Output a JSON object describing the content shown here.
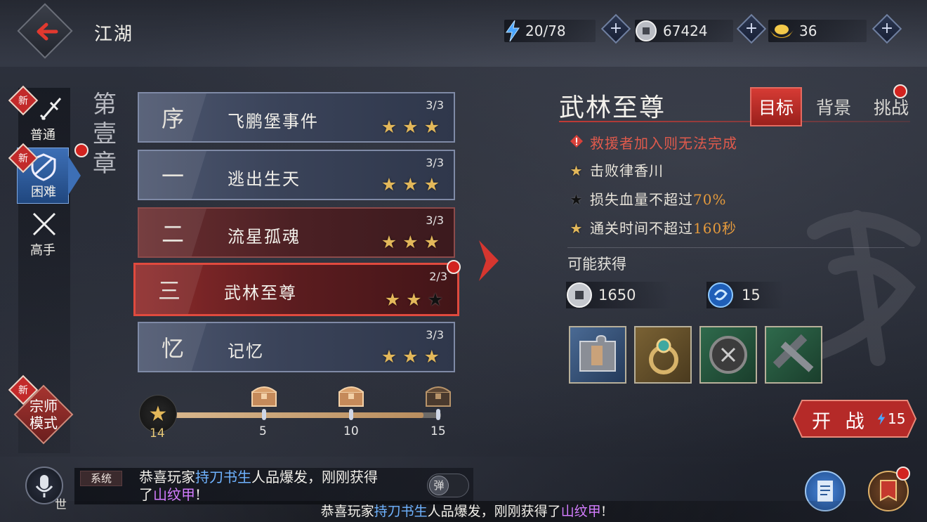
{
  "header": {
    "title": "江湖"
  },
  "resources": {
    "energy": "20/78",
    "coins": "67424",
    "gold": "36",
    "plus": "+"
  },
  "modes": [
    {
      "label": "普通",
      "new": "新"
    },
    {
      "label": "困难",
      "new": "新"
    },
    {
      "label": "高手"
    }
  ],
  "grandmaster": {
    "label_line1": "宗师",
    "label_line2": "模式",
    "new": "新"
  },
  "chapter": {
    "title": "第壹章"
  },
  "stages": [
    {
      "num": "序",
      "name": "飞鹏堡事件",
      "count": "3/3",
      "stars": 3
    },
    {
      "num": "一",
      "name": "逃出生天",
      "count": "3/3",
      "stars": 3
    },
    {
      "num": "二",
      "name": "流星孤魂",
      "count": "3/3",
      "stars": 3
    },
    {
      "num": "三",
      "name": "武林至尊",
      "count": "2/3",
      "stars": 2
    },
    {
      "num": "忆",
      "name": "记忆",
      "count": "3/3",
      "stars": 3
    }
  ],
  "progress": {
    "current": 14,
    "max": 15,
    "current_label": "14",
    "milestones": [
      "5",
      "10",
      "15"
    ]
  },
  "detail": {
    "title": "武林至尊",
    "tabs": [
      "目标",
      "背景",
      "挑战"
    ],
    "conditions": [
      {
        "text": "救援者加入则无法完成",
        "type": "warning"
      },
      {
        "text": "击败律香川",
        "type": "done"
      },
      {
        "text": "损失血量不超过",
        "highlight": "70%",
        "type": "not-done"
      },
      {
        "text": "通关时间不超过",
        "highlight": "160秒",
        "type": "done"
      }
    ],
    "rewards_title": "可能获得",
    "reward_coins": "1650",
    "reward_exp": "15"
  },
  "start": {
    "label": "开 战",
    "cost": "15"
  },
  "chat": {
    "tag": "系统",
    "prefix": "恭喜玩家",
    "player": "持刀书生",
    "middle": "人品爆发，刚刚获得",
    "item_prefix": "了",
    "item": "山纹甲",
    "suffix": "!",
    "toggle": "弹",
    "world": "世"
  },
  "ticker": {
    "prefix": "恭喜玩家",
    "player": "持刀书生",
    "middle": "人品爆发，刚刚获得了",
    "item": "山纹甲",
    "suffix": "!"
  },
  "colors": {
    "accent_red": "#d63b34",
    "star_gold": "#e3b85a",
    "player_blue": "#6fb3ff",
    "item_purple": "#d47dff",
    "highlight_orange": "#e59a3c"
  }
}
